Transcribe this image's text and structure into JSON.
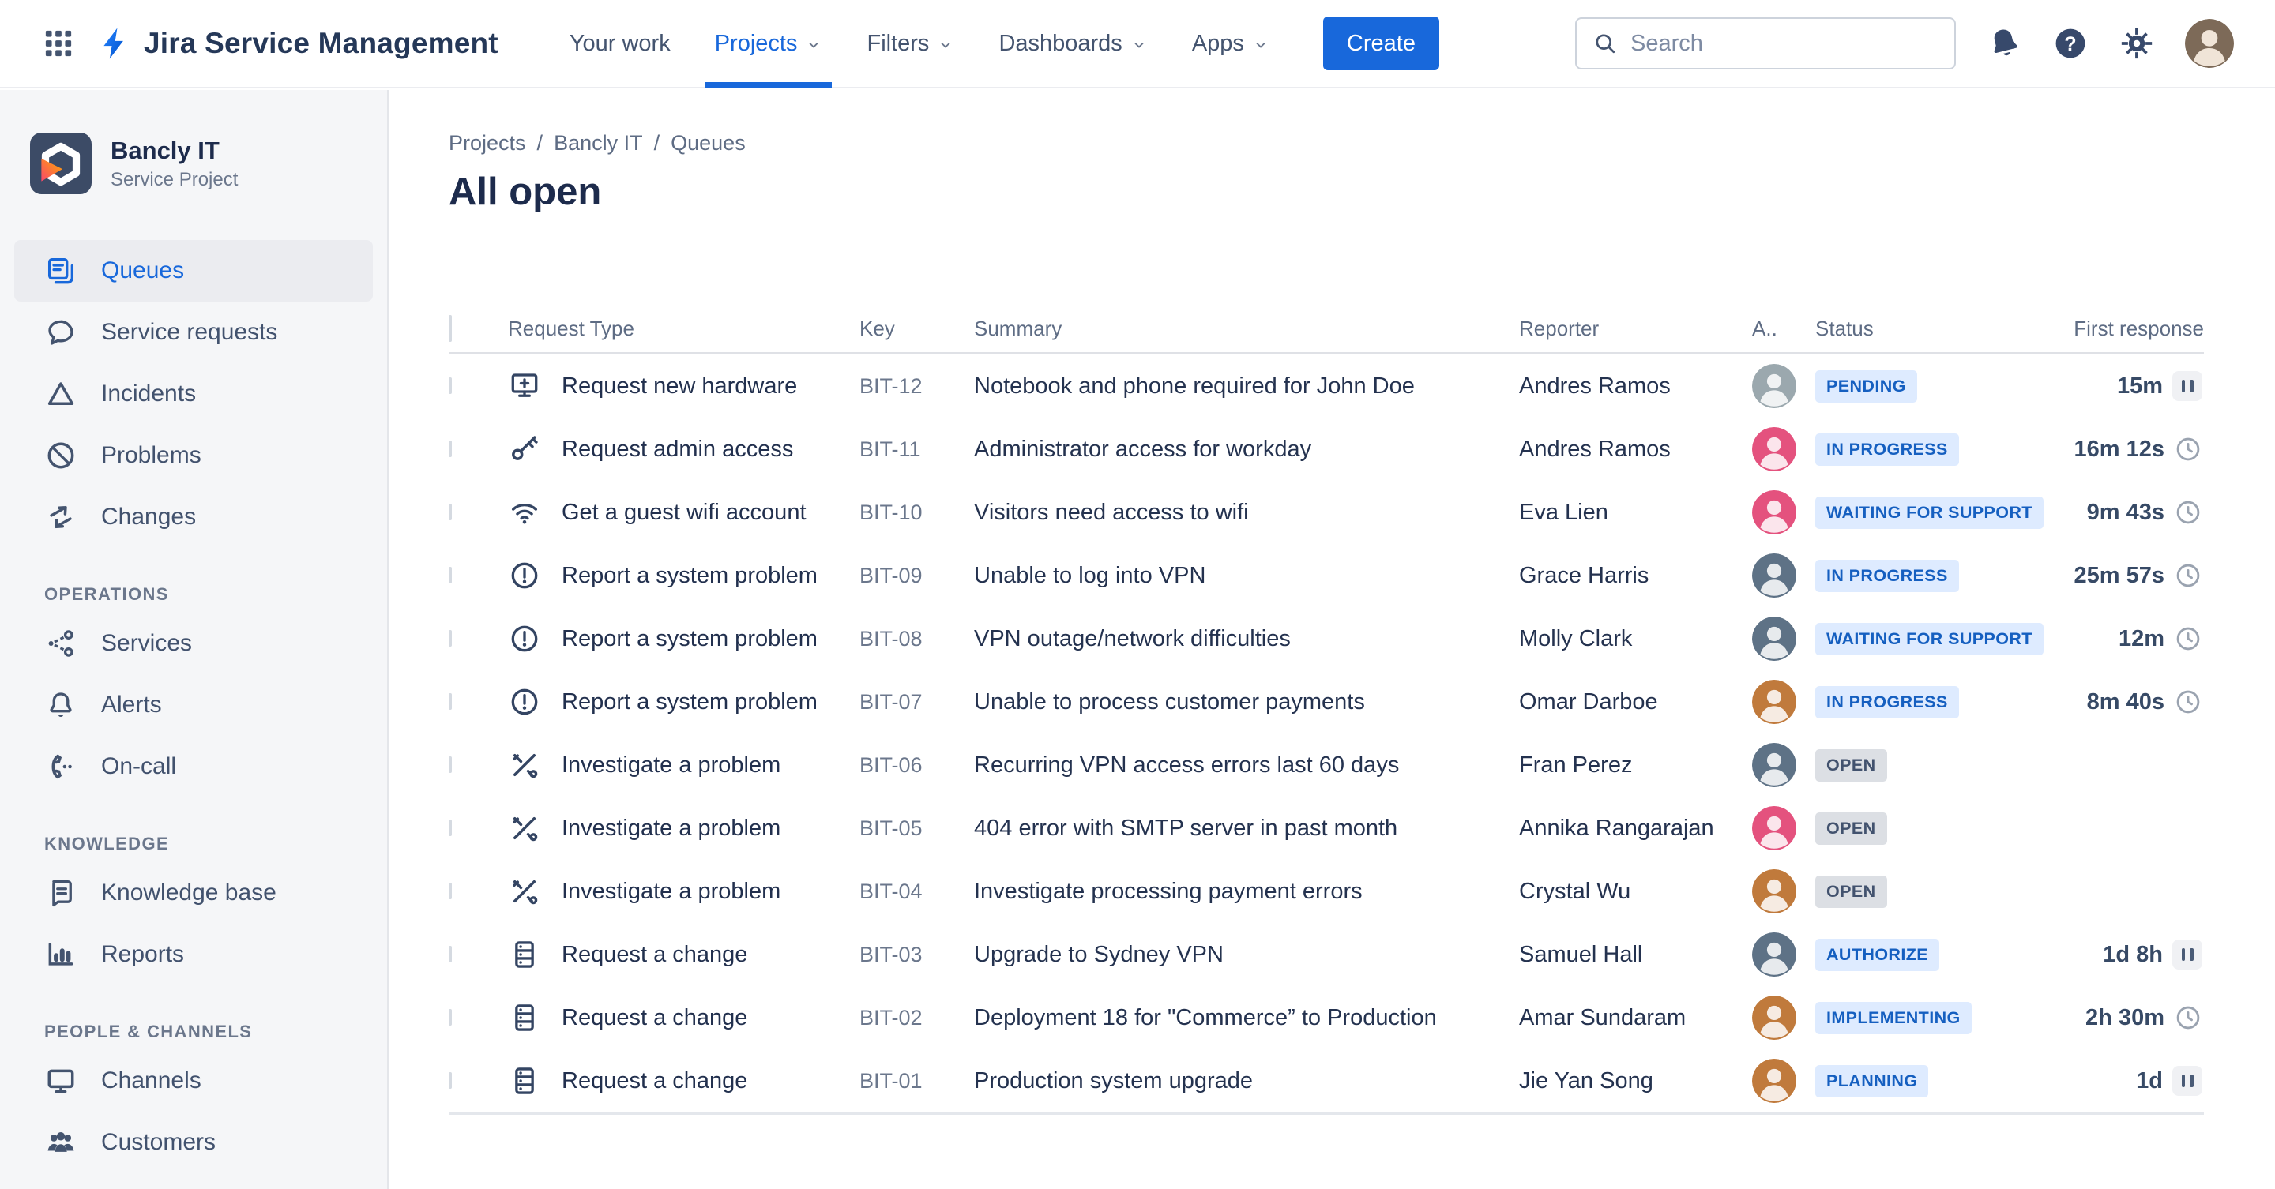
{
  "topbar": {
    "brand": "Jira Service Management",
    "nav": [
      {
        "label": "Your work",
        "chevron": false,
        "active": false
      },
      {
        "label": "Projects",
        "chevron": true,
        "active": true
      },
      {
        "label": "Filters",
        "chevron": true,
        "active": false
      },
      {
        "label": "Dashboards",
        "chevron": true,
        "active": false
      },
      {
        "label": "Apps",
        "chevron": true,
        "active": false
      }
    ],
    "create_label": "Create",
    "search_placeholder": "Search"
  },
  "sidebar": {
    "project": {
      "name": "Bancly IT",
      "type": "Service Project"
    },
    "groups": [
      {
        "header": null,
        "items": [
          {
            "label": "Queues",
            "icon": "queues",
            "selected": true
          },
          {
            "label": "Service requests",
            "icon": "chat",
            "selected": false
          },
          {
            "label": "Incidents",
            "icon": "incident",
            "selected": false
          },
          {
            "label": "Problems",
            "icon": "problem",
            "selected": false
          },
          {
            "label": "Changes",
            "icon": "changes",
            "selected": false
          }
        ]
      },
      {
        "header": "OPERATIONS",
        "items": [
          {
            "label": "Services",
            "icon": "services",
            "selected": false
          },
          {
            "label": "Alerts",
            "icon": "alerts",
            "selected": false
          },
          {
            "label": "On-call",
            "icon": "oncall",
            "selected": false
          }
        ]
      },
      {
        "header": "KNOWLEDGE",
        "items": [
          {
            "label": "Knowledge base",
            "icon": "kb",
            "selected": false
          },
          {
            "label": "Reports",
            "icon": "reports",
            "selected": false
          }
        ]
      },
      {
        "header": "PEOPLE & CHANNELS",
        "items": [
          {
            "label": "Channels",
            "icon": "channels",
            "selected": false
          },
          {
            "label": "Customers",
            "icon": "customers",
            "selected": false
          }
        ]
      }
    ]
  },
  "main": {
    "breadcrumb": [
      "Projects",
      "Bancly IT",
      "Queues"
    ],
    "title": "All open",
    "table": {
      "columns": [
        "Request Type",
        "Key",
        "Summary",
        "Reporter",
        "A..",
        "Status",
        "First response"
      ],
      "rows": [
        {
          "request_type": "Request new hardware",
          "icon": "hardware",
          "key": "BIT-12",
          "summary": "Notebook and phone required for John Doe",
          "reporter": "Andres Ramos",
          "avatar_color": "#9BA8AE",
          "status": "PENDING",
          "status_style": "blue",
          "first_response": "15m",
          "response_icon": "pause"
        },
        {
          "request_type": "Request admin access",
          "icon": "key",
          "key": "BIT-11",
          "summary": "Administrator access for workday",
          "reporter": "Andres Ramos",
          "avatar_color": "#E4527E",
          "status": "IN PROGRESS",
          "status_style": "blue",
          "first_response": "16m 12s",
          "response_icon": "clock"
        },
        {
          "request_type": "Get a guest wifi account",
          "icon": "wifi",
          "key": "BIT-10",
          "summary": "Visitors need access to wifi",
          "reporter": "Eva Lien",
          "avatar_color": "#E4527E",
          "status": "WAITING FOR SUPPORT",
          "status_style": "blue",
          "first_response": "9m 43s",
          "response_icon": "clock"
        },
        {
          "request_type": "Report a system problem",
          "icon": "alert",
          "key": "BIT-09",
          "summary": "Unable to log into VPN",
          "reporter": "Grace Harris",
          "avatar_color": "#5E7286",
          "status": "IN PROGRESS",
          "status_style": "blue",
          "first_response": "25m 57s",
          "response_icon": "clock"
        },
        {
          "request_type": "Report a system problem",
          "icon": "alert",
          "key": "BIT-08",
          "summary": "VPN outage/network difficulties",
          "reporter": "Molly Clark",
          "avatar_color": "#5E7286",
          "status": "WAITING FOR SUPPORT",
          "status_style": "blue",
          "first_response": "12m",
          "response_icon": "clock"
        },
        {
          "request_type": "Report a system problem",
          "icon": "alert",
          "key": "BIT-07",
          "summary": "Unable to process customer payments",
          "reporter": "Omar Darboe",
          "avatar_color": "#C07A3C",
          "status": "IN PROGRESS",
          "status_style": "blue",
          "first_response": "8m 40s",
          "response_icon": "clock"
        },
        {
          "request_type": "Investigate a problem",
          "icon": "tools",
          "key": "BIT-06",
          "summary": "Recurring VPN access errors last 60 days",
          "reporter": "Fran Perez",
          "avatar_color": "#5E7286",
          "status": "OPEN",
          "status_style": "gray",
          "first_response": "",
          "response_icon": ""
        },
        {
          "request_type": "Investigate a problem",
          "icon": "tools",
          "key": "BIT-05",
          "summary": "404 error with SMTP server in past month",
          "reporter": "Annika Rangarajan",
          "avatar_color": "#E4527E",
          "status": "OPEN",
          "status_style": "gray",
          "first_response": "",
          "response_icon": ""
        },
        {
          "request_type": "Investigate a problem",
          "icon": "tools",
          "key": "BIT-04",
          "summary": "Investigate processing payment errors",
          "reporter": "Crystal Wu",
          "avatar_color": "#C07A3C",
          "status": "OPEN",
          "status_style": "gray",
          "first_response": "",
          "response_icon": ""
        },
        {
          "request_type": "Request a change",
          "icon": "server",
          "key": "BIT-03",
          "summary": "Upgrade to Sydney VPN",
          "reporter": "Samuel Hall",
          "avatar_color": "#5E7286",
          "status": "AUTHORIZE",
          "status_style": "blue",
          "first_response": "1d 8h",
          "response_icon": "pause"
        },
        {
          "request_type": "Request a change",
          "icon": "server",
          "key": "BIT-02",
          "summary": "Deployment 18 for \"Commerce” to Production",
          "reporter": "Amar Sundaram",
          "avatar_color": "#C07A3C",
          "status": "IMPLEMENTING",
          "status_style": "blue",
          "first_response": "2h 30m",
          "response_icon": "clock"
        },
        {
          "request_type": "Request a change",
          "icon": "server",
          "key": "BIT-01",
          "summary": "Production system upgrade",
          "reporter": "Jie Yan Song",
          "avatar_color": "#C07A3C",
          "status": "PLANNING",
          "status_style": "blue",
          "first_response": "1d",
          "response_icon": "pause"
        }
      ]
    }
  },
  "colors": {
    "accent": "#1868DB",
    "badge_blue_bg": "#DEEBFF",
    "badge_blue_text": "#155FC0",
    "badge_gray_bg": "#DCDFE4",
    "badge_gray_text": "#42526E",
    "sidebar_bg": "#F5F6F8",
    "navy_text": "#253858"
  }
}
